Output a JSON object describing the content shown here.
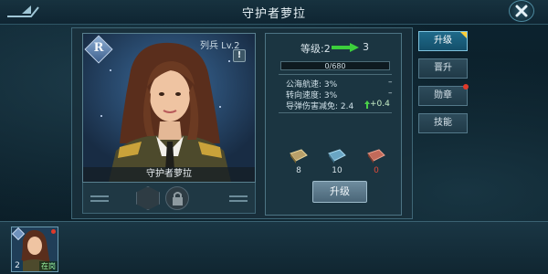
{
  "header": {
    "title": "守护者萝拉"
  },
  "card": {
    "rank_letter": "R",
    "rank_label": "列兵 Lv.2",
    "info_symbol": "!",
    "name": "守护者萝拉"
  },
  "level": {
    "label": "等级:2",
    "next": "3"
  },
  "xp": {
    "text": "0/680",
    "fraction": 0.0
  },
  "stats": [
    {
      "label": "公海航速: 3%",
      "change": "–"
    },
    {
      "label": "转向速度: 3%",
      "change": "–"
    },
    {
      "label": "导弹伤害减免: 2.4",
      "change": "+0.4"
    }
  ],
  "books": [
    {
      "count": "8",
      "color": "#b9a06a"
    },
    {
      "count": "10",
      "color": "#6aa6c4"
    },
    {
      "count": "0",
      "color": "#c26a5a",
      "count_color": "#e04a3a"
    }
  ],
  "upgrade_button": "升级",
  "tabs": [
    {
      "label": "升级",
      "active": true
    },
    {
      "label": "晋升",
      "active": false
    },
    {
      "label": "勋章",
      "active": false
    },
    {
      "label": "技能",
      "active": false
    }
  ],
  "bottom": {
    "thumb_num": "2",
    "thumb_tag": "在岗"
  },
  "colors": {
    "accent": "#1f6a8a",
    "arrow": "#3ccf3c",
    "alert": "#e03a2a"
  }
}
